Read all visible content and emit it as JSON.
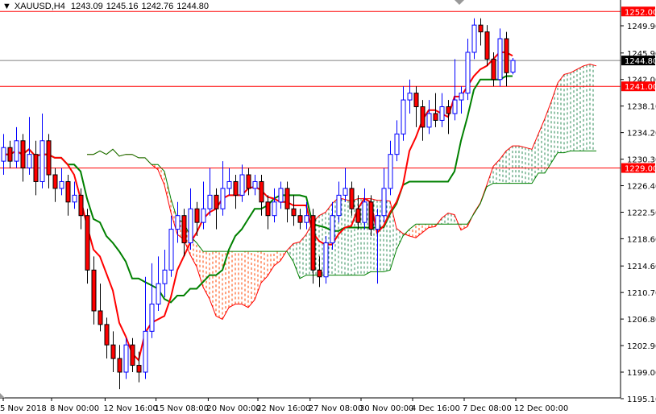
{
  "header": {
    "symbol": "XAUUSD,H4",
    "open": "1243.09",
    "high": "1245.16",
    "low": "1242.76",
    "close": "1244.80"
  },
  "chart_data": {
    "type": "candlestick",
    "title": "XAUUSD,H4",
    "indicator": "Ichimoku Kinko Hyo",
    "ylim": [
      1195.1,
      1252.0
    ],
    "y_ticks": [
      "1249.90",
      "1245.90",
      "1242.00",
      "1238.10",
      "1234.20",
      "1230.30",
      "1226.40",
      "1222.50",
      "1218.60",
      "1214.60",
      "1210.70",
      "1206.80",
      "1202.90",
      "1199.00",
      "1195.10"
    ],
    "x_ticks": [
      {
        "label": "5 Nov 2018",
        "bar": 0
      },
      {
        "label": "8 Nov 00:00",
        "bar": 7.5
      },
      {
        "label": "12 Nov 16:00",
        "bar": 15.8
      },
      {
        "label": "15 Nov 08:00",
        "bar": 23.7
      },
      {
        "label": "20 Nov 00:00",
        "bar": 31.8
      },
      {
        "label": "22 Nov 16:00",
        "bar": 39.5
      },
      {
        "label": "27 Nov 08:00",
        "bar": 47.6
      },
      {
        "label": "30 Nov 00:00",
        "bar": 55.5
      },
      {
        "label": "4 Dec 16:00",
        "bar": 63.5
      },
      {
        "label": "7 Dec 08:00",
        "bar": 71.5
      },
      {
        "label": "12 Dec 00:00",
        "bar": 79.5
      }
    ],
    "levels": [
      {
        "label": "1252.00",
        "value": 1252.0,
        "color": "#ff0000"
      },
      {
        "label": "1241.00",
        "value": 1241.0,
        "color": "#ff0000"
      },
      {
        "label": "1229.00",
        "value": 1229.0,
        "color": "#ff0000"
      }
    ],
    "current_price": {
      "label": "1244.80",
      "value": 1244.8,
      "color": "#808080"
    },
    "colors": {
      "bull": "#0000ff",
      "bear": "#ff0000",
      "tenkan": "#ff0000",
      "kijun": "#008000",
      "span_a": "#ff0000",
      "span_b": "#008000",
      "cloud_up": "#2e8b57",
      "cloud_down": "#ff4500"
    },
    "ichimoku_periods": [
      5,
      13,
      26
    ],
    "ohlc": [
      [
        1230,
        1234,
        1228,
        1232
      ],
      [
        1232,
        1233,
        1229,
        1230
      ],
      [
        1230,
        1235,
        1229,
        1233
      ],
      [
        1233,
        1234,
        1227,
        1229
      ],
      [
        1229,
        1236.5,
        1228,
        1231
      ],
      [
        1231,
        1233,
        1225,
        1227
      ],
      [
        1227,
        1237,
        1226,
        1233
      ],
      [
        1233,
        1234,
        1226,
        1228
      ],
      [
        1228,
        1229,
        1224,
        1226
      ],
      [
        1226,
        1229,
        1225,
        1227
      ],
      [
        1227,
        1228,
        1222,
        1224
      ],
      [
        1224,
        1227,
        1223,
        1225
      ],
      [
        1225,
        1226,
        1220,
        1222
      ],
      [
        1222,
        1223,
        1212,
        1214
      ],
      [
        1214,
        1216,
        1206,
        1208
      ],
      [
        1208,
        1212,
        1205,
        1206
      ],
      [
        1206,
        1207,
        1201,
        1203
      ],
      [
        1203,
        1205,
        1199,
        1201
      ],
      [
        1201,
        1203,
        1196.5,
        1199
      ],
      [
        1199,
        1204,
        1198,
        1203
      ],
      [
        1203,
        1204,
        1199,
        1200
      ],
      [
        1200,
        1202,
        1197.5,
        1199
      ],
      [
        1199,
        1213,
        1198,
        1205
      ],
      [
        1205,
        1215,
        1204,
        1209
      ],
      [
        1209,
        1216,
        1208,
        1212
      ],
      [
        1212,
        1217,
        1210,
        1214
      ],
      [
        1214,
        1222,
        1213,
        1220
      ],
      [
        1220,
        1224,
        1218,
        1222
      ],
      [
        1222,
        1223,
        1216,
        1218
      ],
      [
        1218,
        1226,
        1217,
        1223
      ],
      [
        1223,
        1224,
        1219,
        1221
      ],
      [
        1221,
        1227,
        1220,
        1223
      ],
      [
        1223,
        1229,
        1222,
        1225
      ],
      [
        1225,
        1226,
        1220,
        1223
      ],
      [
        1223,
        1230,
        1222,
        1226
      ],
      [
        1226,
        1229,
        1225,
        1227
      ],
      [
        1227,
        1228,
        1223,
        1225
      ],
      [
        1225,
        1229.5,
        1224,
        1228
      ],
      [
        1228,
        1229,
        1225,
        1226
      ],
      [
        1226,
        1228,
        1225,
        1227
      ],
      [
        1227,
        1228,
        1222,
        1224
      ],
      [
        1224,
        1225,
        1220,
        1222
      ],
      [
        1222,
        1226,
        1221,
        1224
      ],
      [
        1224,
        1227,
        1223,
        1226
      ],
      [
        1226,
        1227,
        1221,
        1223
      ],
      [
        1223,
        1225,
        1220.5,
        1222
      ],
      [
        1222,
        1223,
        1220,
        1221
      ],
      [
        1221,
        1224,
        1220,
        1222
      ],
      [
        1222,
        1223,
        1212,
        1214
      ],
      [
        1214,
        1216,
        1211.5,
        1213
      ],
      [
        1213,
        1219,
        1212,
        1218
      ],
      [
        1218,
        1224,
        1217,
        1222
      ],
      [
        1222,
        1227,
        1221,
        1225
      ],
      [
        1225,
        1229,
        1224,
        1226
      ],
      [
        1226,
        1227,
        1222,
        1223
      ],
      [
        1223,
        1225,
        1220,
        1221
      ],
      [
        1221,
        1226,
        1220,
        1224
      ],
      [
        1224,
        1225,
        1219,
        1220
      ],
      [
        1220,
        1223,
        1212,
        1222
      ],
      [
        1222,
        1229,
        1221,
        1226
      ],
      [
        1226,
        1233,
        1225,
        1231
      ],
      [
        1231,
        1236,
        1230,
        1234
      ],
      [
        1234,
        1241,
        1233,
        1239
      ],
      [
        1239,
        1242,
        1237,
        1240
      ],
      [
        1240,
        1241,
        1235,
        1238
      ],
      [
        1238,
        1239,
        1233,
        1235
      ],
      [
        1235,
        1239,
        1234,
        1237
      ],
      [
        1237,
        1240,
        1235,
        1236
      ],
      [
        1236,
        1240,
        1235,
        1238
      ],
      [
        1238,
        1239,
        1234,
        1237
      ],
      [
        1237,
        1245,
        1236,
        1239
      ],
      [
        1239,
        1241,
        1237,
        1240
      ],
      [
        1240,
        1248,
        1239,
        1246
      ],
      [
        1246,
        1251,
        1245,
        1250
      ],
      [
        1250,
        1251,
        1247,
        1249
      ],
      [
        1249,
        1250,
        1244,
        1245
      ],
      [
        1245,
        1246,
        1241,
        1242
      ],
      [
        1242,
        1249.5,
        1241,
        1248
      ],
      [
        1248,
        1249,
        1241,
        1243
      ],
      [
        1243.09,
        1245.16,
        1242.76,
        1244.8
      ]
    ]
  }
}
